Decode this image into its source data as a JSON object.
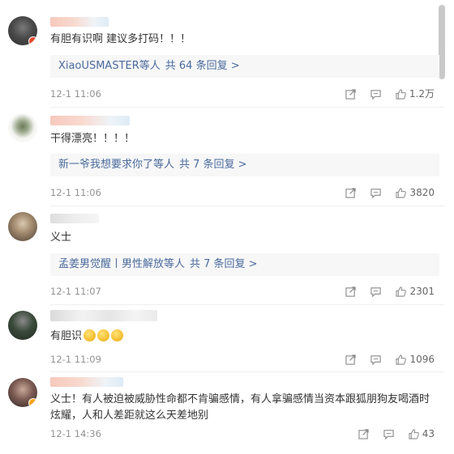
{
  "comments": [
    {
      "text": "有胆有识啊 建议多打码！！！",
      "replies_users": "XiaoUSMASTER等人",
      "replies_count": "共 64 条回复 >",
      "time": "12-1 11:06",
      "likes": "1.2万"
    },
    {
      "text": "干得漂亮！！！！",
      "replies_users": "新一爷我想要求你了等人",
      "replies_count": "共 7 条回复 >",
      "time": "12-1 11:06",
      "likes": "3820"
    },
    {
      "text": "义士",
      "replies_users": "孟姜男觉醒丨男性解放等人",
      "replies_count": "共 7 条回复 >",
      "time": "12-1 11:07",
      "likes": "2301"
    },
    {
      "text": "有胆识",
      "time": "12-1 11:09",
      "likes": "1096"
    },
    {
      "text": "义士！有人被迫被威胁性命都不肯骗感情，有人拿骗感情当资本跟狐朋狗友喝酒时炫耀，人和人差距就这么天差地别",
      "time": "12-1 14:36",
      "likes": "43"
    }
  ],
  "icons": {
    "share": "share-icon",
    "comment": "comment-icon",
    "like": "thumbs-up-icon",
    "emoji": "sweat-smile-emoji-icon"
  },
  "colors": {
    "link": "#4a6a9d",
    "meta": "#939393",
    "reply_bg": "#f7f7f7"
  }
}
